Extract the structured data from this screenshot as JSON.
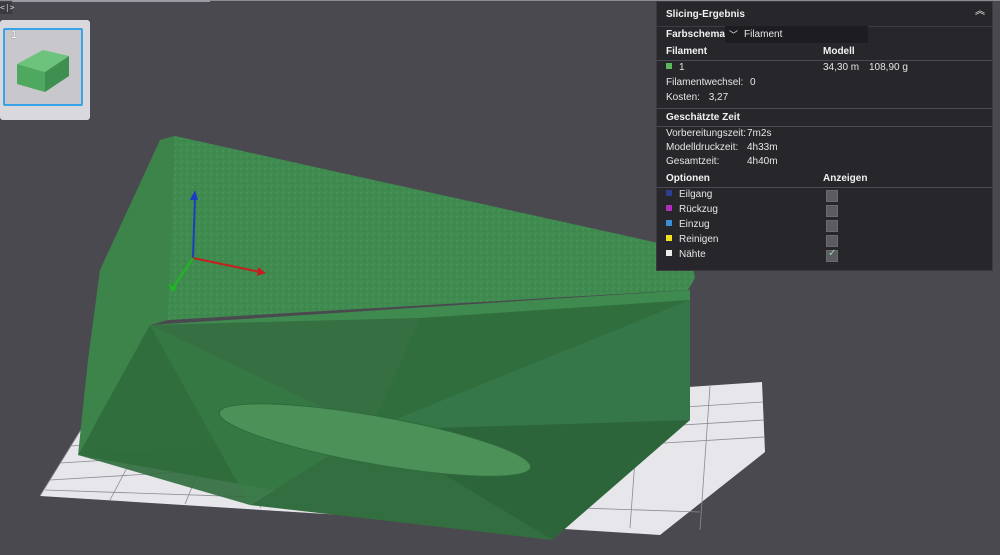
{
  "panel": {
    "title": "Slicing-Ergebnis",
    "color_scheme_label": "Farbschema",
    "color_scheme_value": "Filament",
    "filament_header": "Filament",
    "model_header": "Modell",
    "filament_row": {
      "id": "1",
      "length": "34,30 m",
      "weight": "108,90 g",
      "color": "#5cb85c"
    },
    "filament_changes_label": "Filamentwechsel:",
    "filament_changes_value": "0",
    "cost_label": "Kosten:",
    "cost_value": "3,27",
    "time_header": "Geschätzte Zeit",
    "prep_label": "Vorbereitungszeit:",
    "prep_value": "7m2s",
    "model_time_label": "Modelldruckzeit:",
    "model_time_value": "4h33m",
    "total_label": "Gesamtzeit:",
    "total_value": "4h40m",
    "options_header": "Optionen",
    "show_header": "Anzeigen",
    "options": [
      {
        "label": "Eilgang",
        "color": "#2f3f8f",
        "checked": false
      },
      {
        "label": "Rückzug",
        "color": "#b02fb8",
        "checked": false
      },
      {
        "label": "Einzug",
        "color": "#3a8fd6",
        "checked": false
      },
      {
        "label": "Reinigen",
        "color": "#f0e020",
        "checked": false
      },
      {
        "label": "Nähte",
        "color": "#ececec",
        "checked": true
      }
    ]
  },
  "plate": {
    "number": "1"
  },
  "colors": {
    "background": "#4a4950",
    "model": "#3f8a4e",
    "grid": "#e8e8ee"
  }
}
